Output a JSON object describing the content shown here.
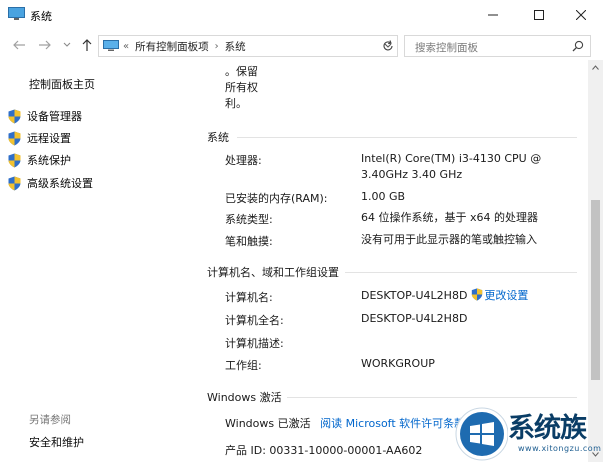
{
  "window": {
    "title": "系统"
  },
  "address": {
    "overflow": "«",
    "crumbs": [
      "所有控制面板项",
      "系统"
    ],
    "search_placeholder": "搜索控制面板"
  },
  "sidebar": {
    "home": "控制面板主页",
    "items": [
      {
        "label": "设备管理器",
        "icon": "shield-icon"
      },
      {
        "label": "远程设置",
        "icon": "shield-icon"
      },
      {
        "label": "系统保护",
        "icon": "shield-icon"
      },
      {
        "label": "高级系统设置",
        "icon": "shield-icon"
      }
    ],
    "see_also": "另请参阅",
    "security": "安全和维护"
  },
  "main": {
    "top_fragment": [
      "。保留",
      "所有权",
      "利。"
    ],
    "system": {
      "title": "系统",
      "rows": [
        {
          "label": "处理器:",
          "value": "Intel(R) Core(TM) i3-4130 CPU @",
          "value2": "3.40GHz   3.40 GHz"
        },
        {
          "label": "已安装的内存(RAM):",
          "value": "1.00 GB"
        },
        {
          "label": "系统类型:",
          "value": "64 位操作系统，基于 x64 的处理器"
        },
        {
          "label": "笔和触摸:",
          "value": "没有可用于此显示器的笔或触控输入"
        }
      ]
    },
    "computer": {
      "title": "计算机名、域和工作组设置",
      "rows": [
        {
          "label": "计算机名:",
          "value": "DESKTOP-U4L2H8D"
        },
        {
          "label": "计算机全名:",
          "value": "DESKTOP-U4L2H8D"
        },
        {
          "label": "计算机描述:",
          "value": ""
        },
        {
          "label": "工作组:",
          "value": "WORKGROUP"
        }
      ],
      "change_link": "更改设置"
    },
    "activation": {
      "title": "Windows 激活",
      "status": "Windows 已激活",
      "link": "阅读 Microsoft 软件许可条款",
      "product_id": "产品 ID: 00331-10000-00001-AA602"
    }
  },
  "watermark": {
    "text": "系统族",
    "url": "www.xitongzu.com"
  },
  "colors": {
    "link": "#0066cc",
    "rule": "#e3e3e3",
    "watermark": "#0a3d66"
  }
}
